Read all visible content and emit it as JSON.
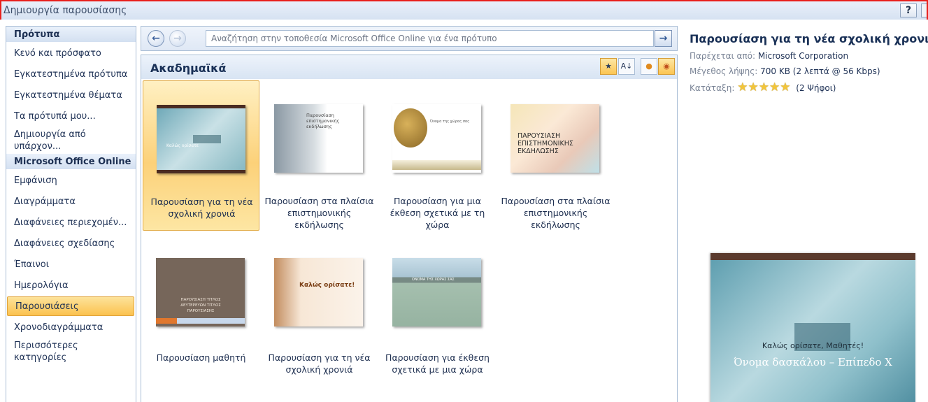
{
  "window": {
    "title": "Δημιουργία παρουσίασης",
    "help_label": "?"
  },
  "sidebar": {
    "section1_header": "Πρότυπα",
    "section1_items": [
      {
        "label": "Κενό και πρόσφατο"
      },
      {
        "label": "Εγκατεστημένα πρότυπα"
      },
      {
        "label": "Εγκατεστημένα θέματα"
      },
      {
        "label": "Τα πρότυπά μου..."
      },
      {
        "label": "Δημιουργία από υπάρχον..."
      }
    ],
    "section2_header": "Microsoft Office Online",
    "section2_items": [
      {
        "label": "Εμφάνιση"
      },
      {
        "label": "Διαγράμματα"
      },
      {
        "label": "Διαφάνειες περιεχομέν..."
      },
      {
        "label": "Διαφάνειες σχεδίασης"
      },
      {
        "label": "Έπαινοι"
      },
      {
        "label": "Ημερολόγια"
      },
      {
        "label": "Παρουσιάσεις",
        "selected": true
      },
      {
        "label": "Χρονοδιαγράμματα"
      },
      {
        "label": "Περισσότερες κατηγορίες"
      }
    ]
  },
  "navbar": {
    "back_icon": "←",
    "forward_icon": "→",
    "search_placeholder": "Αναζήτηση στην τοποθεσία Microsoft Office Online για ένα πρότυπο",
    "go_icon": "→"
  },
  "content": {
    "heading": "Ακαδημαϊκά",
    "tools": [
      {
        "icon": "★",
        "name": "sort-by-rating-icon",
        "active": true
      },
      {
        "icon": "A↓",
        "name": "sort-alphabetical-icon",
        "active": false
      },
      {
        "icon": "●",
        "name": "view-author-icon",
        "active": false
      },
      {
        "icon": "◉",
        "name": "view-author-filter-icon",
        "active": true
      }
    ],
    "templates": [
      {
        "label": "Παρουσίαση για τη νέα σχολική χρονιά",
        "thumb_text": "Καλώς ορίσατε",
        "selected": true
      },
      {
        "label": "Παρουσίαση στα πλαίσια επιστημονικής εκδήλωσης",
        "thumb_text": "Παρουσίαση επιστημονικής εκδήλωσης"
      },
      {
        "label": "Παρουσίαση για μια έκθεση σχετικά με τη χώρα",
        "thumb_text": "Όνομα της χώρας σας"
      },
      {
        "label": "Παρουσίαση στα πλαίσια επιστημονικής εκδήλωσης",
        "thumb_text": "ΠΑΡΟΥΣΙΑΣΗ ΕΠΙΣΤΗΜΟΝΙΚΗΣ ΕΚΔΗΛΩΣΗΣ"
      },
      {
        "label": "Παρουσίαση μαθητή",
        "thumb_text": "ΠΑΡΟΥΣΙΑΣΗ ΤΙΤΛΟΣ ΔΕΥΤΕΡΕΥΩΝ ΤΙΤΛΟΣ ΠΑΡΟΥΣΙΑΣΗΣ"
      },
      {
        "label": "Παρουσίαση για τη νέα σχολική χρονιά",
        "thumb_text": "Καλώς ορίσατε!"
      },
      {
        "label": "Παρουσίαση για έκθεση σχετικά με μια χώρα",
        "thumb_text": "ΟΝΟΜΑ ΤΗΣ ΧΩΡΑΣ ΣΑΣ"
      }
    ]
  },
  "details": {
    "title": "Παρουσίαση για τη νέα σχολική χρονιά",
    "provider_label": "Παρέχεται από:",
    "provider_value": "Microsoft Corporation",
    "size_label": "Μέγεθος λήψης:",
    "size_value": "700 KB (2 λεπτά @ 56 Kbps)",
    "rating_label": "Κατάταξη:",
    "rating_stars": 5,
    "rating_votes": "(2 Ψήφοι)",
    "preview": {
      "line1": "Καλώς ορίσατε, Μαθητές!",
      "line2": "Όνομα δασκάλου – Επίπεδο Χ"
    }
  }
}
